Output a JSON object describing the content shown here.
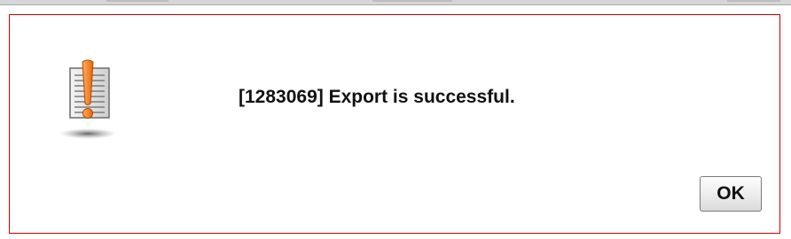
{
  "dialog": {
    "message": "[1283069] Export is successful.",
    "icon": "warning-document-icon",
    "ok_label": "OK"
  },
  "colors": {
    "border": "#cc0000",
    "icon_accent": "#f07a1a"
  }
}
